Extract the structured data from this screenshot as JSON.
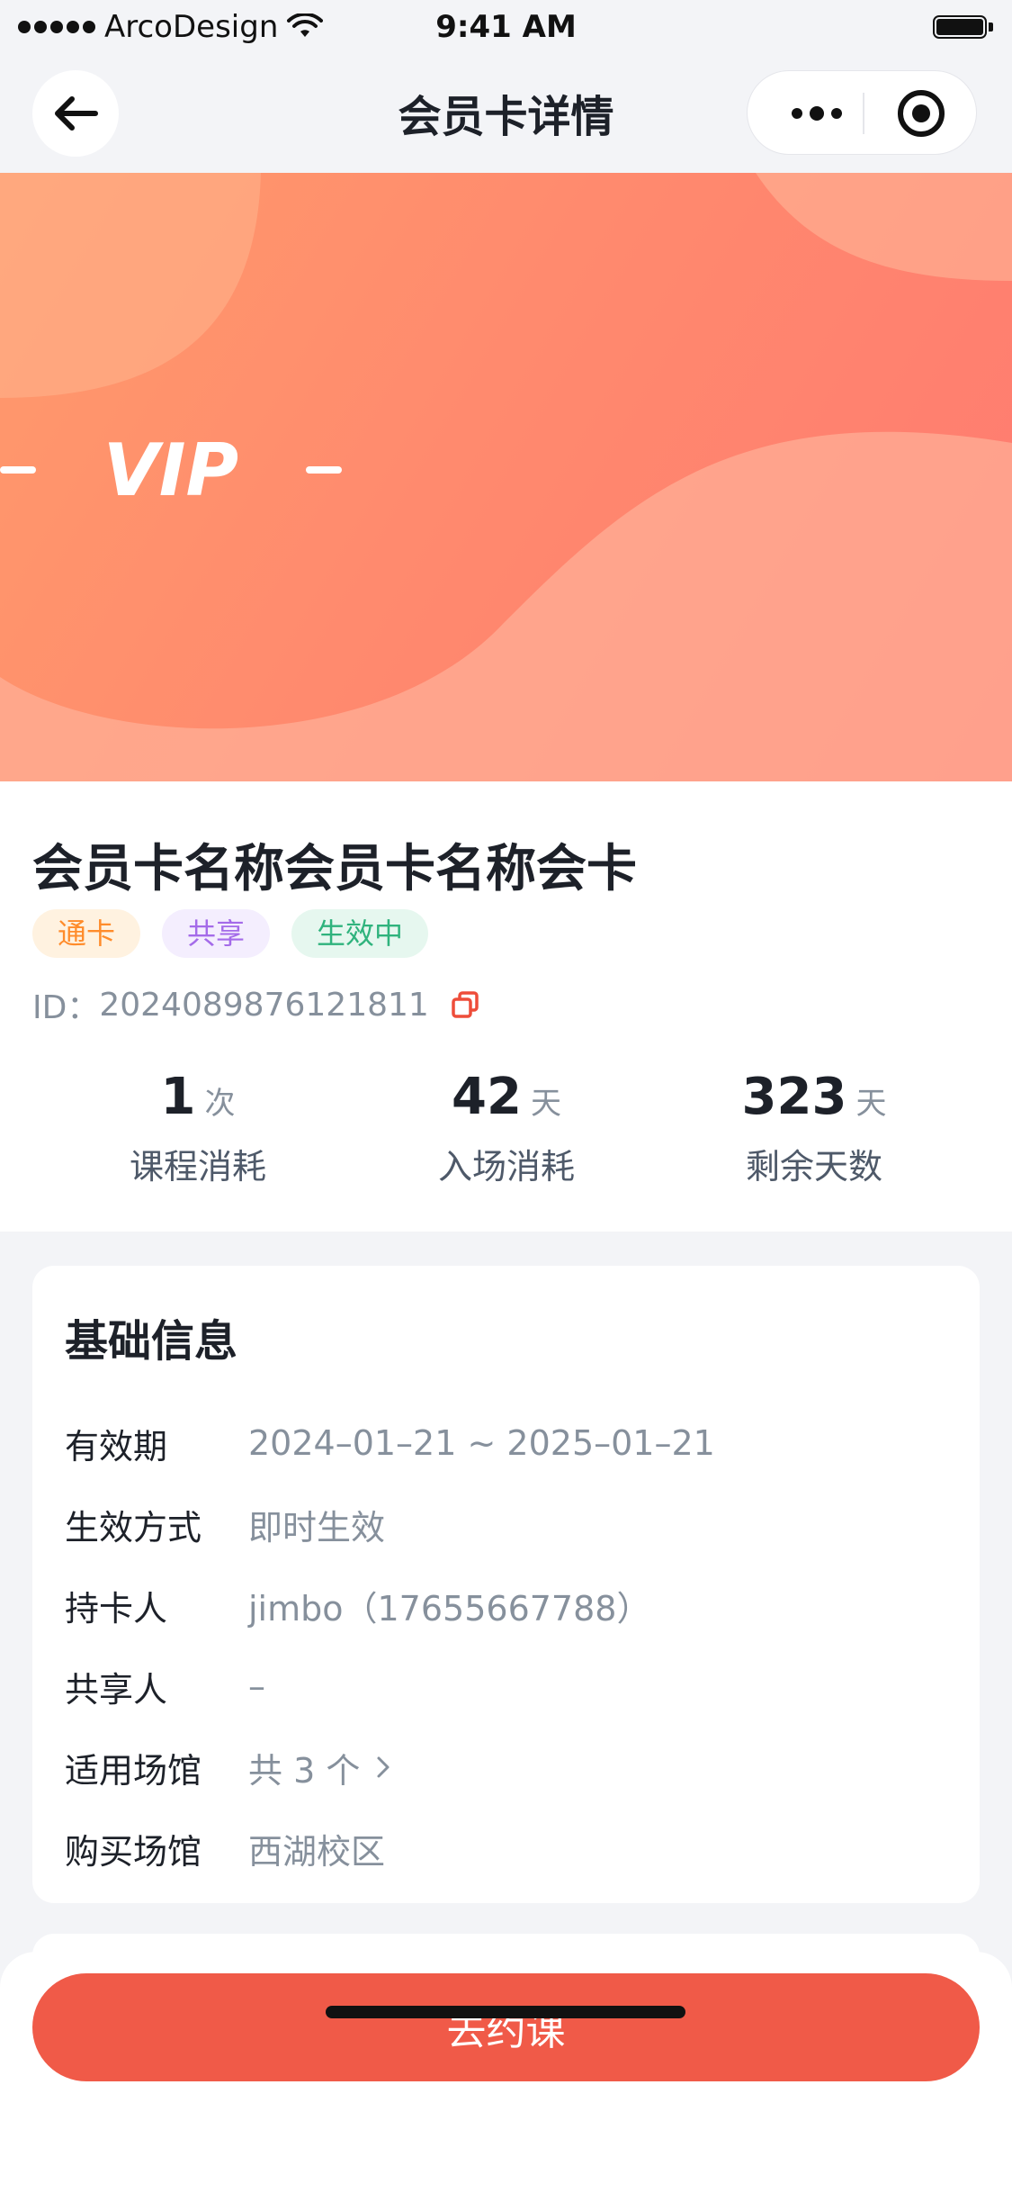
{
  "status_bar": {
    "carrier": "ArcoDesign",
    "time": "9:41 AM"
  },
  "nav": {
    "title": "会员卡详情"
  },
  "banner": {
    "label": "VIP"
  },
  "card": {
    "name": "会员卡名称会员卡名称会卡",
    "tags": [
      "通卡",
      "共享",
      "生效中"
    ],
    "id_label": "ID：",
    "id_value": "2024089876121811"
  },
  "stats": [
    {
      "value": "1",
      "unit": "次",
      "label": "课程消耗"
    },
    {
      "value": "42",
      "unit": "天",
      "label": "入场消耗"
    },
    {
      "value": "323",
      "unit": "天",
      "label": "剩余天数"
    }
  ],
  "basic_info": {
    "title": "基础信息",
    "rows": [
      {
        "key": "有效期",
        "value": "2024–01–21 ~ 2025–01–21"
      },
      {
        "key": "生效方式",
        "value": "即时生效"
      },
      {
        "key": "持卡人",
        "value": "jimbo（17655667788）"
      },
      {
        "key": "共享人",
        "value": "–"
      },
      {
        "key": "适用场馆",
        "value": "共 3 个"
      },
      {
        "key": "购买场馆",
        "value": "西湖校区"
      }
    ]
  },
  "bottom": {
    "button_label": "去约课"
  },
  "colors": {
    "accent": "#f05a48",
    "banner_start": "#ff9a6b",
    "banner_end": "#ff7a70"
  }
}
